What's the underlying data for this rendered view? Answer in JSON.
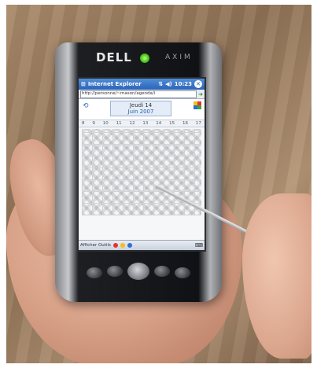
{
  "device": {
    "brand": "DELL",
    "model": "AXIM",
    "power_led_color": "#46c21b"
  },
  "browser": {
    "title": "Internet Explorer",
    "time": "10:23",
    "url": "http://personne/~mason/agenda/i"
  },
  "calendar": {
    "day_label": "Jeudi 14",
    "month_label": "Juin 2007",
    "hours": [
      "8",
      "9",
      "10",
      "11",
      "12",
      "13",
      "14",
      "15",
      "16",
      "17"
    ]
  },
  "taskbar": {
    "label": "Afficher Outils"
  },
  "colors": {
    "titlebar": "#2c63b7",
    "skin": "#d9a38a",
    "wall": "#a98a6a"
  },
  "icons": [
    "windows-logo-icon",
    "signal-icon",
    "volume-icon",
    "close-icon",
    "go-arrow-icon",
    "keyboard-icon"
  ]
}
